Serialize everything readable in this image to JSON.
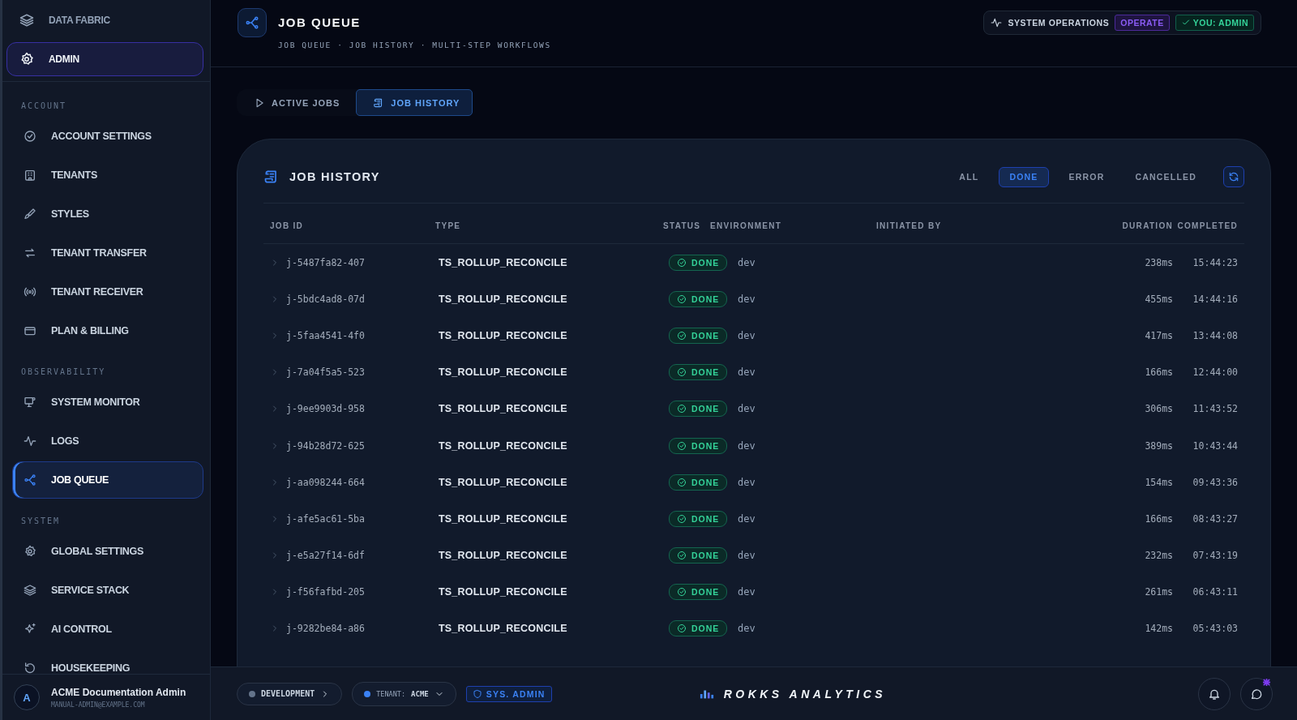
{
  "sidebar": {
    "top_items": [
      {
        "label": "DATA FABRIC",
        "selected": false
      },
      {
        "label": "ADMIN",
        "selected": true
      }
    ],
    "sections": [
      {
        "title": "ACCOUNT",
        "items": [
          {
            "label": "ACCOUNT SETTINGS",
            "selected": false
          },
          {
            "label": "TENANTS",
            "selected": false
          },
          {
            "label": "STYLES",
            "selected": false
          },
          {
            "label": "TENANT TRANSFER",
            "selected": false
          },
          {
            "label": "TENANT RECEIVER",
            "selected": false
          },
          {
            "label": "PLAN & BILLING",
            "selected": false
          }
        ]
      },
      {
        "title": "OBSERVABILITY",
        "items": [
          {
            "label": "SYSTEM MONITOR",
            "selected": false
          },
          {
            "label": "LOGS",
            "selected": false
          },
          {
            "label": "JOB QUEUE",
            "selected": true
          }
        ]
      },
      {
        "title": "SYSTEM",
        "items": [
          {
            "label": "GLOBAL SETTINGS",
            "selected": false
          },
          {
            "label": "SERVICE STACK",
            "selected": false
          },
          {
            "label": "AI CONTROL",
            "selected": false
          },
          {
            "label": "HOUSEKEEPING",
            "selected": false
          }
        ]
      }
    ],
    "user": {
      "initial": "A",
      "name": "ACME Documentation Admin",
      "email": "MANUAL-ADMIN@EXAMPLE.COM"
    }
  },
  "header": {
    "title": "JOB QUEUE",
    "breadcrumb": "JOB QUEUE · JOB HISTORY · MULTI-STEP WORKFLOWS",
    "ops": {
      "label": "SYSTEM OPERATIONS",
      "mode": "OPERATE",
      "role": "YOU: ADMIN"
    }
  },
  "tabs": [
    {
      "label": "ACTIVE JOBS",
      "selected": false
    },
    {
      "label": "JOB HISTORY",
      "selected": true
    }
  ],
  "card": {
    "title": "JOB HISTORY",
    "filters": [
      {
        "label": "ALL",
        "selected": false
      },
      {
        "label": "DONE",
        "selected": true
      },
      {
        "label": "ERROR",
        "selected": false
      },
      {
        "label": "CANCELLED",
        "selected": false
      }
    ],
    "columns": [
      "JOB ID",
      "TYPE",
      "STATUS",
      "ENVIRONMENT",
      "INITIATED BY",
      "DURATION",
      "COMPLETED"
    ],
    "rows": [
      {
        "id": "j-5487fa82-407",
        "type": "TS_ROLLUP_RECONCILE",
        "status": "DONE",
        "environment": "dev",
        "duration": "238ms",
        "completed": "15:44:23"
      },
      {
        "id": "j-5bdc4ad8-07d",
        "type": "TS_ROLLUP_RECONCILE",
        "status": "DONE",
        "environment": "dev",
        "duration": "455ms",
        "completed": "14:44:16"
      },
      {
        "id": "j-5faa4541-4f0",
        "type": "TS_ROLLUP_RECONCILE",
        "status": "DONE",
        "environment": "dev",
        "duration": "417ms",
        "completed": "13:44:08"
      },
      {
        "id": "j-7a04f5a5-523",
        "type": "TS_ROLLUP_RECONCILE",
        "status": "DONE",
        "environment": "dev",
        "duration": "166ms",
        "completed": "12:44:00"
      },
      {
        "id": "j-9ee9903d-958",
        "type": "TS_ROLLUP_RECONCILE",
        "status": "DONE",
        "environment": "dev",
        "duration": "306ms",
        "completed": "11:43:52"
      },
      {
        "id": "j-94b28d72-625",
        "type": "TS_ROLLUP_RECONCILE",
        "status": "DONE",
        "environment": "dev",
        "duration": "389ms",
        "completed": "10:43:44"
      },
      {
        "id": "j-aa098244-664",
        "type": "TS_ROLLUP_RECONCILE",
        "status": "DONE",
        "environment": "dev",
        "duration": "154ms",
        "completed": "09:43:36"
      },
      {
        "id": "j-afe5ac61-5ba",
        "type": "TS_ROLLUP_RECONCILE",
        "status": "DONE",
        "environment": "dev",
        "duration": "166ms",
        "completed": "08:43:27"
      },
      {
        "id": "j-e5a27f14-6df",
        "type": "TS_ROLLUP_RECONCILE",
        "status": "DONE",
        "environment": "dev",
        "duration": "232ms",
        "completed": "07:43:19"
      },
      {
        "id": "j-f56fafbd-205",
        "type": "TS_ROLLUP_RECONCILE",
        "status": "DONE",
        "environment": "dev",
        "duration": "261ms",
        "completed": "06:43:11"
      },
      {
        "id": "j-9282be84-a86",
        "type": "TS_ROLLUP_RECONCILE",
        "status": "DONE",
        "environment": "dev",
        "duration": "142ms",
        "completed": "05:43:03"
      }
    ]
  },
  "footer": {
    "environment": "DEVELOPMENT",
    "tenant_label": "TENANT:",
    "tenant": "ACME",
    "role_badge": "SYS. ADMIN",
    "brand": "ROKKS ANALYTICS"
  }
}
